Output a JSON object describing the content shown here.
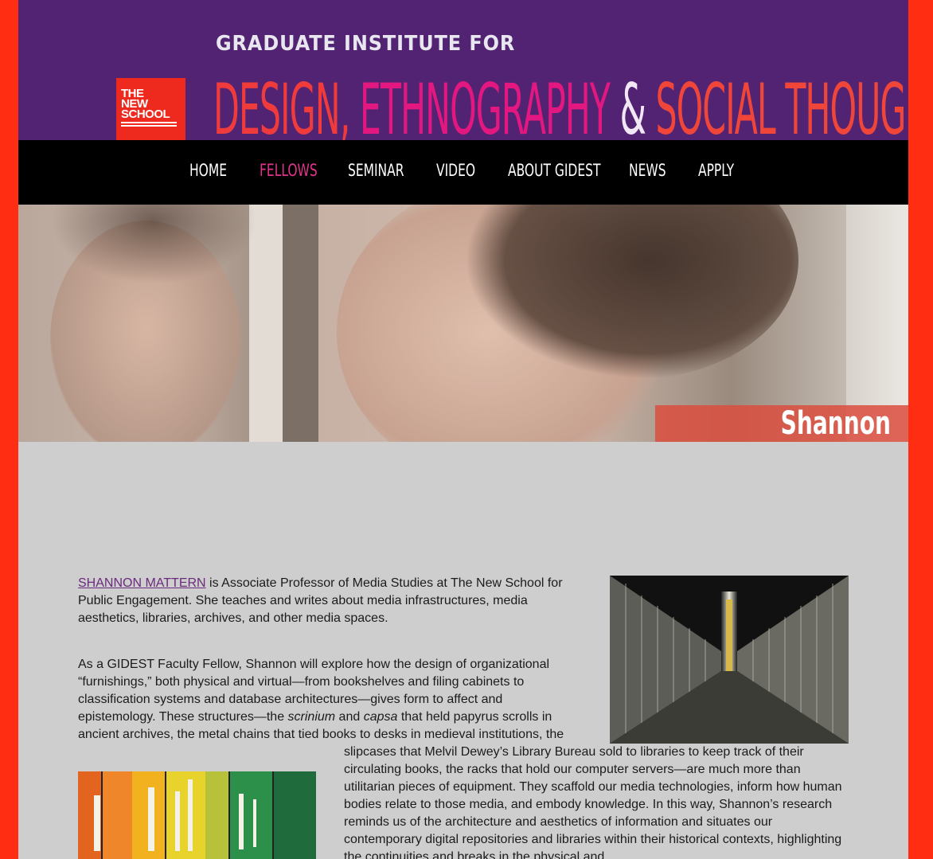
{
  "header": {
    "logo_lines": [
      "THE",
      "NEW",
      "SCHOOL"
    ],
    "kicker": "GRADUATE INSTITUTE FOR",
    "title_part1": "DESIGN,",
    "title_part2": "ETHNOGRAPHY",
    "title_amp": "&",
    "title_part3": "SOCIAL THOUGHT"
  },
  "nav": {
    "items": [
      {
        "label": "HOME"
      },
      {
        "label": "FELLOWS",
        "active": true
      },
      {
        "label": "SEMINAR"
      },
      {
        "label": "VIDEO"
      },
      {
        "label": "ABOUT GIDEST"
      },
      {
        "label": "NEWS"
      },
      {
        "label": "APPLY"
      }
    ]
  },
  "hero": {
    "name": "Shannon Mattern"
  },
  "content": {
    "p1_link": "SHANNON MATTERN",
    "p1_text": " is Associate Professor of Media Studies at The New School for Public Engagement. She teaches and writes about media infrastructures, media aesthetics, libraries, archives, and other media spaces.",
    "p2_a": "As a GIDEST Faculty Fellow, Shannon will explore how the design of organizational “furnishings,” both physical and virtual—from bookshelves and filing cabinets to classification systems and database architectures—gives form to affect and epistemology. These structures—the ",
    "p2_em1": "scrinium",
    "p2_b": " and ",
    "p2_em2": "capsa",
    "p2_c": " that held papyrus scrolls in ancient archives, the metal chains that tied books to desks in medieval institutions, the",
    "p3": "slipcases that Melvil Dewey’s Library Bureau sold to libraries to keep track of their circulating books, the racks that hold our computer servers—are much more than utilitarian pieces of equipment. They scaffold our media technologies, inform how human bodies relate to those media, and embody knowledge. In this way, Shannon’s research reminds us of the architecture and aesthetics of information and situates our contemporary digital repositories and libraries within their historical contexts, highlighting the continuities and breaks in the physical and"
  },
  "colors": {
    "frame": "#ff2e12",
    "banner": "#522372",
    "nav_active": "#e2348d",
    "link": "#6b2a7d"
  }
}
